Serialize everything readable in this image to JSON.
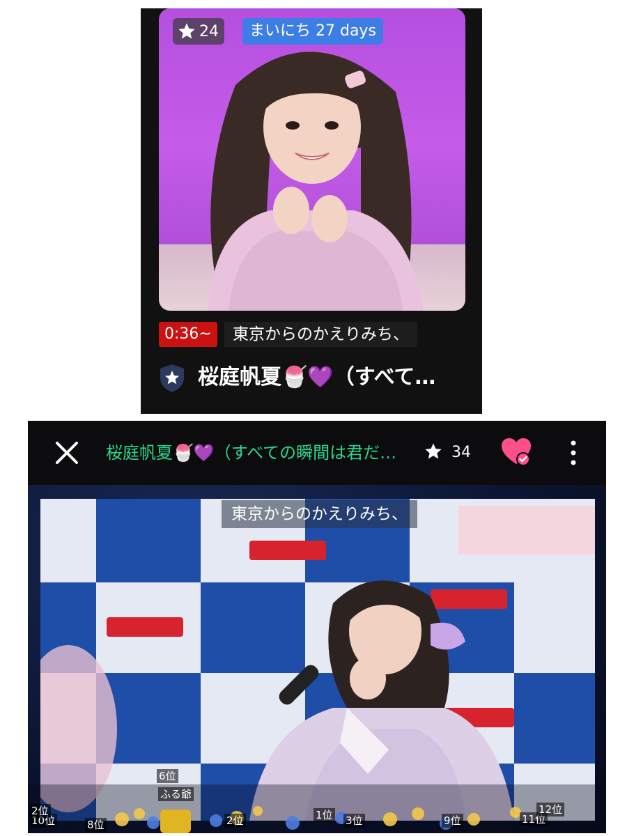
{
  "top_card": {
    "star_count": "24",
    "days_badge": "まいにち 27 days",
    "time_tag": "0:36~",
    "subtitle": "東京からのかえりみち、",
    "title": "桜庭帆夏🍧💜（すべて…"
  },
  "player": {
    "title": "桜庭帆夏🍧💜（すべての瞬間は君だ…",
    "star_count": "34",
    "subtitle": "東京からのかえりみち、",
    "rank_labels": [
      "6位",
      "ふる爺",
      "2位",
      "10位",
      "8位",
      "2位",
      "1位",
      "3位",
      "9位",
      "11位",
      "12位"
    ]
  },
  "icons": {
    "star": "star-icon",
    "shield": "shield-star-icon",
    "close": "close-icon",
    "heart": "heart-check-icon",
    "more": "more-vertical-icon"
  },
  "colors": {
    "purple_bg": "#c45ce8",
    "badge_blue": "#3d7ee6",
    "time_red": "#cc1111",
    "title_green": "#27d98b",
    "heart_pink": "#ff4f8b",
    "video_blue": "#1f4ea8"
  }
}
